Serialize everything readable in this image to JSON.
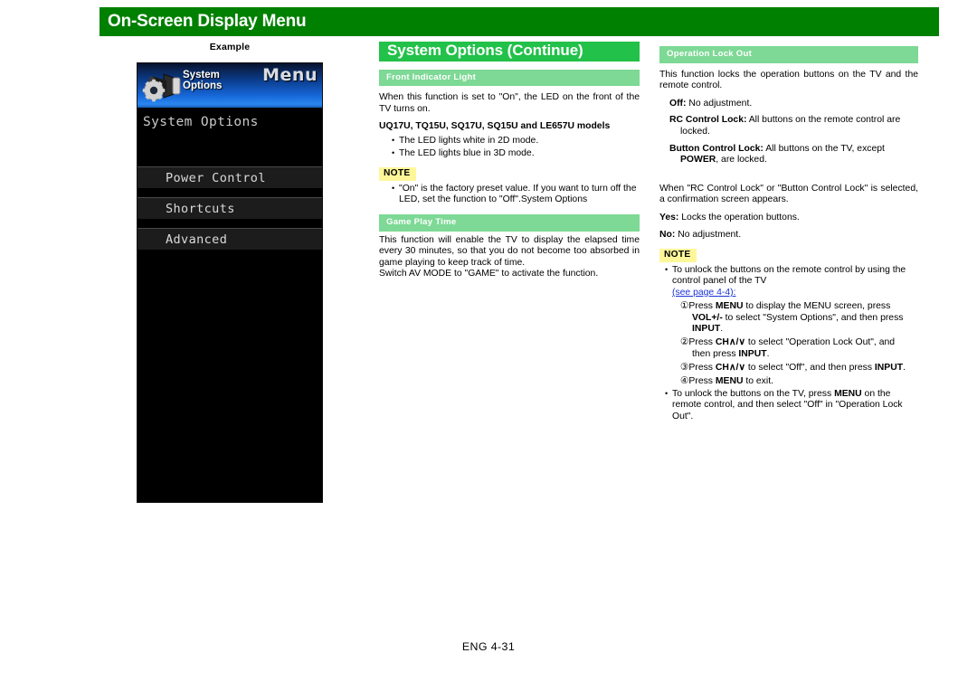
{
  "page": {
    "title": "On-Screen Display Menu",
    "footer": "ENG  4-31"
  },
  "left_column": {
    "example_label": "Example",
    "tv_screen": {
      "header": {
        "icon_name": "system-options-gear-plug-icon",
        "icon_title_line1": "System",
        "icon_title_line2": "Options",
        "menu_word": "Menu"
      },
      "breadcrumb": "System Options",
      "menu_items": [
        {
          "label": "Power Control"
        },
        {
          "label": "Shortcuts"
        },
        {
          "label": "Advanced"
        }
      ]
    }
  },
  "middle_column": {
    "section_title": "System Options (Continue)",
    "subsections": [
      {
        "heading": "Front Indicator Light",
        "intro": "When this function is set to \"On\", the LED on the front of the TV turns on.",
        "models_heading": "UQ17U, TQ15U, SQ17U, SQ15U and LE657U models",
        "model_bullets": [
          "The LED lights white in 2D mode.",
          "The LED lights blue in 3D mode."
        ],
        "note_label": "NOTE",
        "note_bullets": [
          "\"On\" is the factory preset value. If you want to turn off the LED, set the function to \"Off\".System Options"
        ]
      },
      {
        "heading": "Game Play Time",
        "body_line1": "This function will enable the TV to display the elapsed time every 30 minutes, so that you do not become too absorbed in game playing to keep track of time.",
        "body_line2": "Switch AV MODE to \"GAME\" to activate the function."
      }
    ]
  },
  "right_column": {
    "heading": "Operation Lock Out",
    "intro": "This function locks the operation buttons on the TV and the remote control.",
    "options": [
      {
        "term": "Off:",
        "desc": " No adjustment.",
        "cont": ""
      },
      {
        "term": "RC Control Lock:",
        "desc": " All buttons on the remote control are",
        "cont": "locked."
      },
      {
        "term": "Button Control Lock:",
        "desc": " All buttons on the TV, except",
        "cont": "POWER, are locked."
      }
    ],
    "confirm_para": "When \"RC Control Lock\" or \"Button Control Lock\" is selected, a confirmation screen appears.",
    "confirm_options": [
      {
        "term": "Yes:",
        "desc": " Locks the operation buttons."
      },
      {
        "term": "No:",
        "desc": " No adjustment."
      }
    ],
    "note_label": "NOTE",
    "note_intro_bullet": "To unlock the buttons on the remote control by using the control panel of the TV",
    "note_link": "(see page 4-4):",
    "steps": [
      {
        "num": "①",
        "line1_pre": "Press ",
        "line1_bold": "MENU",
        "line1_post": " to display the MENU screen, press",
        "line2_bold": "VOL+/-",
        "line2_post": " to select \"System Options\", and then press",
        "line3_bold": "INPUT",
        "line3_post": "."
      },
      {
        "num": "②",
        "line1_pre": "Press ",
        "line1_bold": "CH∧/∨",
        "line1_post": " to select \"Operation Lock Out\", and",
        "line2_pre": "then press ",
        "line2_bold": "INPUT",
        "line2_post": "."
      },
      {
        "num": "③",
        "line1_pre": "Press ",
        "line1_bold": "CH∧/∨",
        "line1_post": " to select \"Off\", and then press ",
        "line1_bold2": "INPUT",
        "line1_post2": "."
      },
      {
        "num": "④",
        "line1_pre": "Press ",
        "line1_bold": "MENU",
        "line1_post": " to exit."
      }
    ],
    "final_bullet_pre": "To unlock the buttons on the TV, press ",
    "final_bullet_bold": "MENU",
    "final_bullet_post": " on the remote control, and then select \"Off\" in \"Operation Lock Out\"."
  }
}
